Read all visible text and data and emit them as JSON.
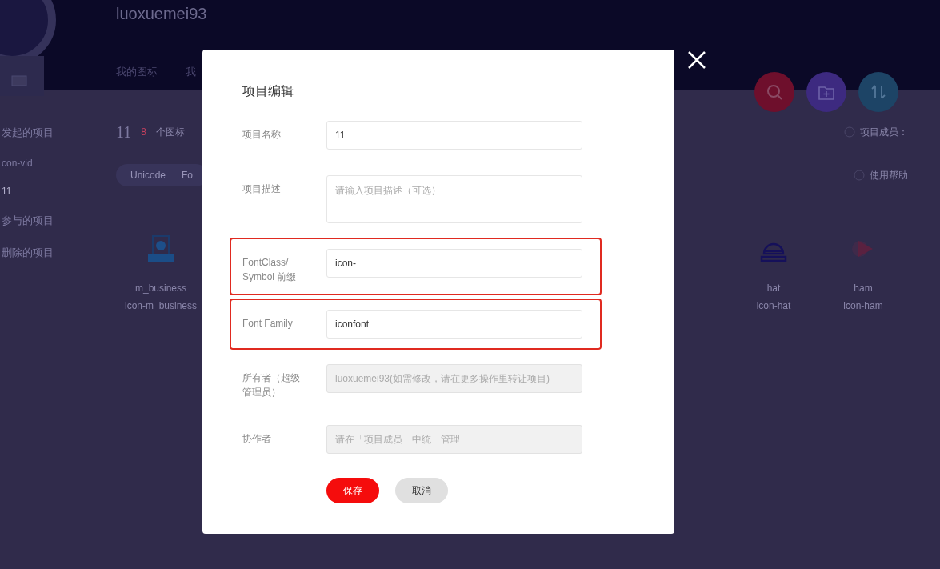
{
  "header": {
    "username": "luoxuemei93",
    "nav": [
      "我的图标",
      "我"
    ]
  },
  "sidebar": {
    "sections": [
      {
        "title": "发起的项目",
        "children": [
          {
            "label": "con-vid",
            "selected": false
          },
          {
            "label": "11",
            "selected": true
          }
        ]
      },
      {
        "title": "参与的项目"
      },
      {
        "title": "删除的项目"
      }
    ]
  },
  "project": {
    "name": "11",
    "count": "8",
    "count_label": "个图标",
    "members_label": "项目成员：",
    "help": "使用帮助"
  },
  "tabs": [
    "Unicode",
    "Fo"
  ],
  "icons": [
    {
      "kind": "business",
      "name": "m_business",
      "class_name": "icon-m_business"
    },
    {
      "kind": "hat",
      "name": "hat",
      "class_name": "icon-hat"
    },
    {
      "kind": "ham",
      "name": "ham",
      "class_name": "icon-ham"
    }
  ],
  "action_buttons": [
    {
      "kind": "search",
      "color": "#6e0f2c"
    },
    {
      "kind": "add-folder",
      "color": "#3d2a80"
    },
    {
      "kind": "sort",
      "color": "#1d4466"
    }
  ],
  "dialog": {
    "title": "项目编辑",
    "fields": [
      {
        "label": "项目名称",
        "kind": "input",
        "value": "11",
        "disabled": false,
        "highlighted": false
      },
      {
        "label": "项目描述",
        "kind": "textarea",
        "placeholder": "请输入项目描述（可选）",
        "disabled": false,
        "highlighted": false
      },
      {
        "label": "FontClass/\nSymbol 前缀",
        "kind": "input",
        "value": "icon-",
        "disabled": false,
        "highlighted": true
      },
      {
        "label": "Font Family",
        "kind": "input",
        "value": "iconfont",
        "disabled": false,
        "highlighted": true
      },
      {
        "label": "所有者（超级管理员）",
        "kind": "input",
        "placeholder": "luoxuemei93(如需修改，请在更多操作里转让项目)",
        "disabled": true,
        "highlighted": false
      },
      {
        "label": "协作者",
        "kind": "input",
        "placeholder": "请在「项目成员」中统一管理",
        "disabled": true,
        "highlighted": false
      }
    ],
    "buttons": [
      {
        "label": "保存",
        "kind": "primary"
      },
      {
        "label": "取消",
        "kind": "secondary"
      }
    ]
  }
}
